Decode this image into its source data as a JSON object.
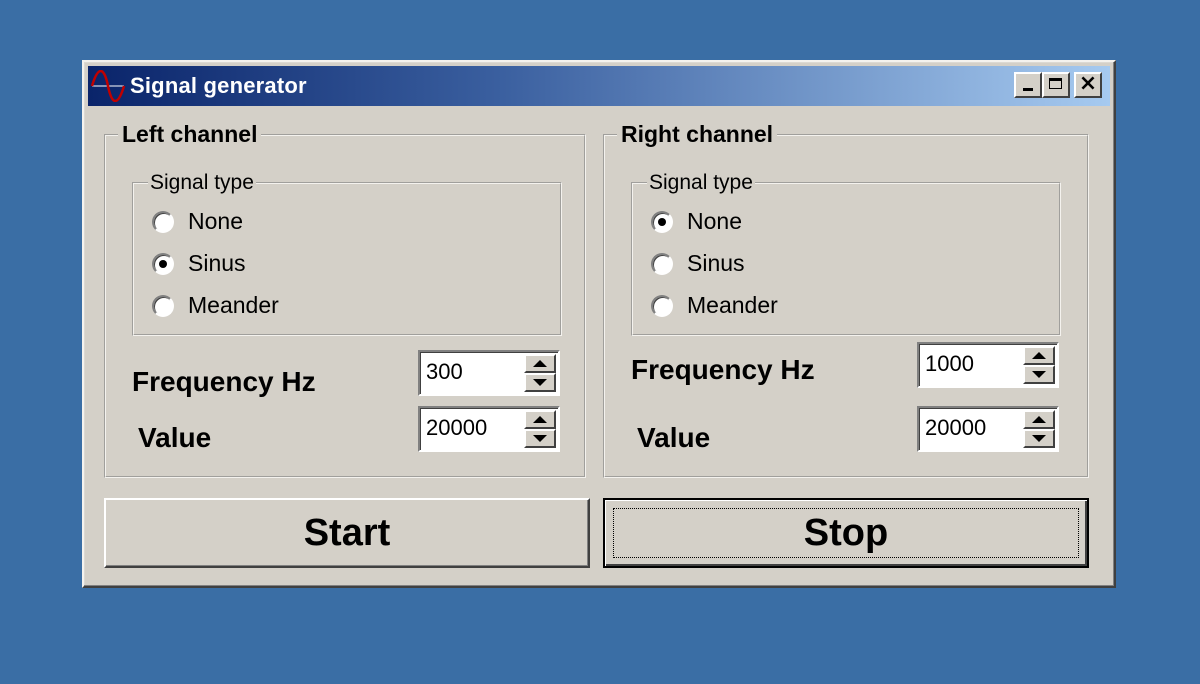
{
  "window": {
    "title": "Signal generator",
    "icon": "sine-wave-icon",
    "controls": {
      "minimize": "minimize-icon",
      "maximize": "maximize-icon",
      "close": "×"
    }
  },
  "colors": {
    "desktop": "#3a6ea5",
    "face": "#d4d0c8",
    "title_start": "#0a246a",
    "title_end": "#a6caf0",
    "sine_icon": "#c00000"
  },
  "left_channel": {
    "title": "Left channel",
    "signal_type": {
      "title": "Signal type",
      "options": [
        {
          "label": "None",
          "checked": false
        },
        {
          "label": "Sinus",
          "checked": true
        },
        {
          "label": "Meander",
          "checked": false
        }
      ]
    },
    "frequency": {
      "label": "Frequency Hz",
      "value": "300"
    },
    "value": {
      "label": "Value",
      "value": "20000"
    }
  },
  "right_channel": {
    "title": "Right channel",
    "signal_type": {
      "title": "Signal type",
      "options": [
        {
          "label": "None",
          "checked": true
        },
        {
          "label": "Sinus",
          "checked": false
        },
        {
          "label": "Meander",
          "checked": false
        }
      ]
    },
    "frequency": {
      "label": "Frequency Hz",
      "value": "1000"
    },
    "value": {
      "label": "Value",
      "value": "20000"
    }
  },
  "buttons": {
    "start": "Start",
    "stop": "Stop"
  }
}
